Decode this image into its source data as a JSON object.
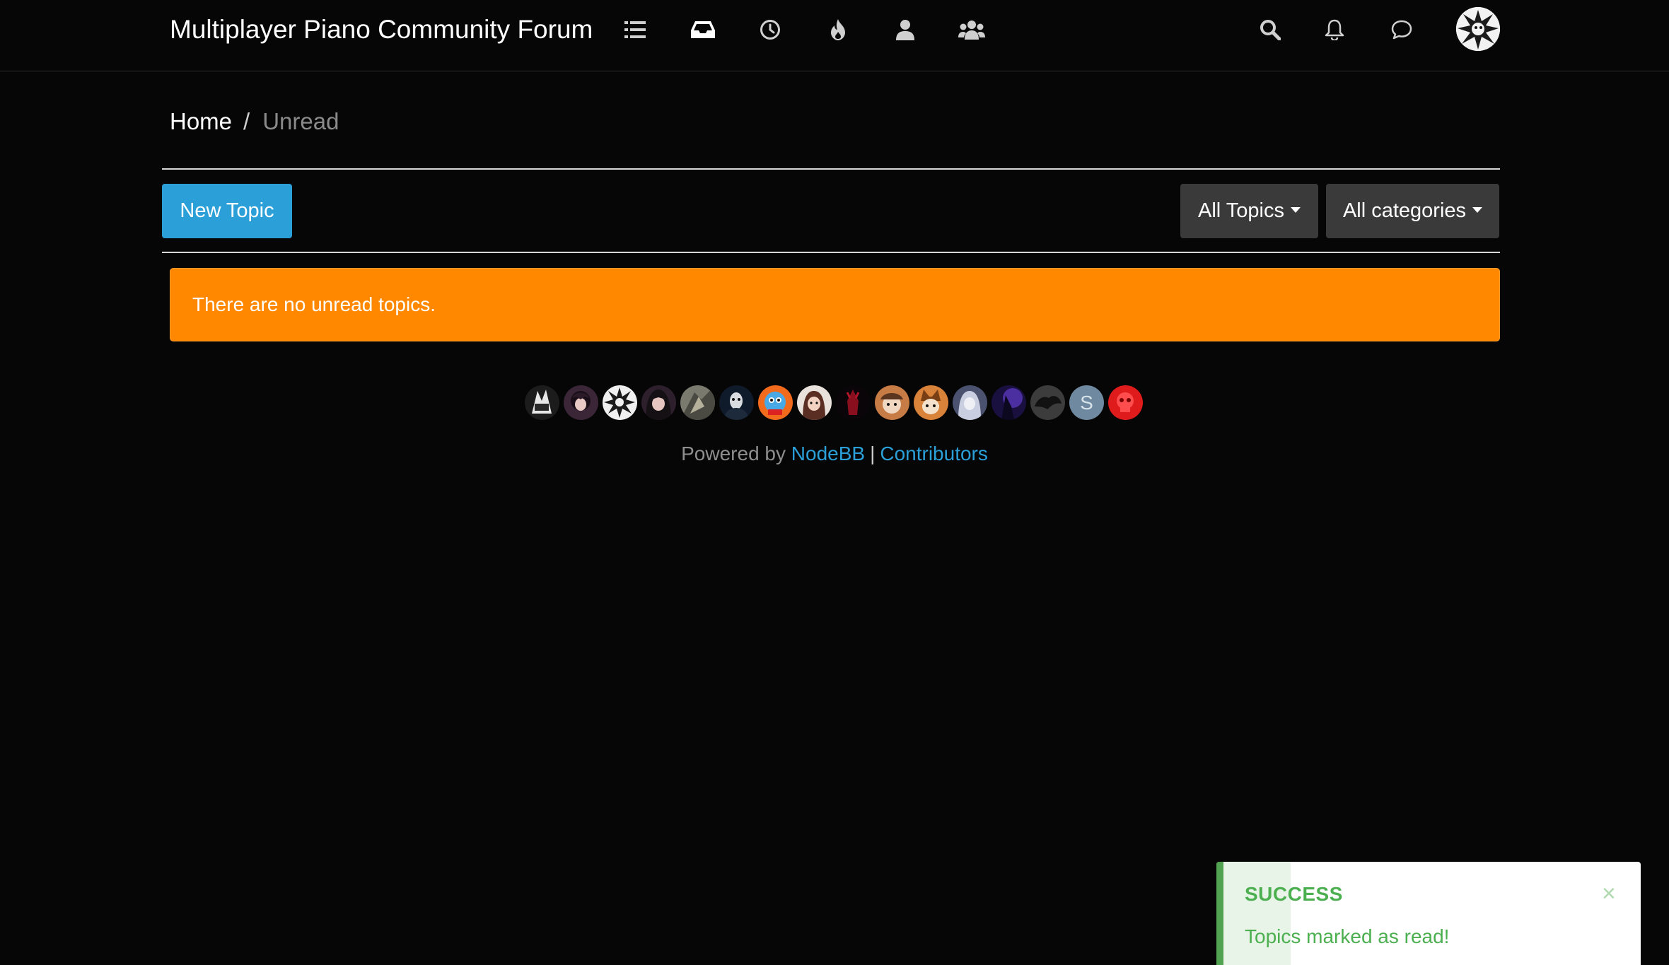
{
  "header": {
    "brand": "Multiplayer Piano Community Forum",
    "nav_icons": [
      "list-icon",
      "inbox-icon",
      "clock-icon",
      "fire-icon",
      "user-icon",
      "users-icon"
    ],
    "right_icons": [
      "search-icon",
      "bell-icon",
      "chat-icon"
    ]
  },
  "breadcrumb": {
    "home": "Home",
    "separator": "/",
    "current": "Unread"
  },
  "toolbar": {
    "new_topic": "New Topic",
    "filter_topics": "All Topics",
    "filter_categories": "All categories"
  },
  "alert": {
    "message": "There are no unread topics."
  },
  "contributors": {
    "count": 16,
    "letter_avatar": "S"
  },
  "footer": {
    "powered_by": "Powered by",
    "nodebb_link": "NodeBB",
    "pipe": "|",
    "contributors_link": "Contributors"
  },
  "toast": {
    "title": "SUCCESS",
    "message": "Topics marked as read!",
    "close": "×"
  },
  "colors": {
    "background": "#060606",
    "primary": "#2a9fd8",
    "warning": "#ff8800",
    "success": "#51a351",
    "dropdown": "#3a3a3a"
  }
}
